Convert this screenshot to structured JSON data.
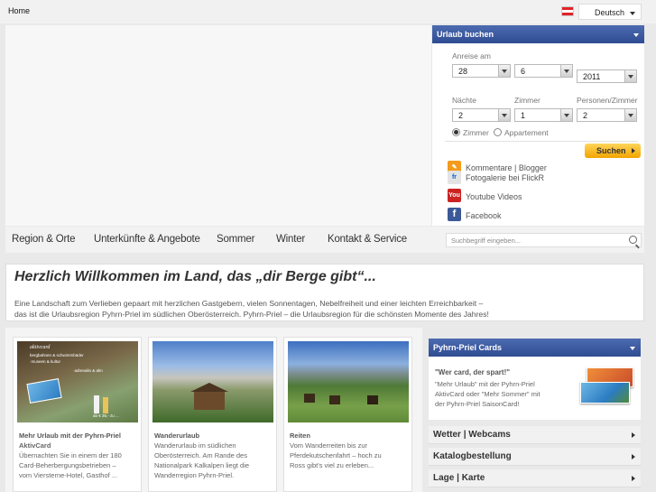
{
  "topbar": {
    "home": "Home",
    "language": "Deutsch"
  },
  "booking": {
    "title": "Urlaub buchen",
    "arrival_label": "Anreise am",
    "day": "28",
    "month": "6",
    "year": "2011",
    "nights_label": "Nächte",
    "rooms_label": "Zimmer",
    "persons_label": "Personen/Zimmer",
    "nights": "2",
    "rooms": "1",
    "persons": "2",
    "option_room": "Zimmer",
    "option_apartment": "Appartement",
    "search_button": "Suchen",
    "social": [
      {
        "label": "Kommentare | Blogger",
        "icon": "blogger-icon",
        "color": "#f29b1c"
      },
      {
        "label": "Fotogalerie bei FlickR",
        "icon": "flickr-icon",
        "color": "#e3e3e3"
      },
      {
        "label": "Youtube Videos",
        "icon": "youtube-icon",
        "color": "#cc2222"
      },
      {
        "label": "Facebook",
        "icon": "facebook-icon",
        "color": "#3b5998"
      }
    ]
  },
  "nav": {
    "items": [
      "Region & Orte",
      "Unterkünfte & Angebote",
      "Sommer",
      "Winter",
      "Kontakt & Service"
    ],
    "search_placeholder": "Suchbegriff eingeben..."
  },
  "welcome": {
    "title": "Herzlich Willkommen im Land, das „dir Berge gibt“...",
    "line1": "Eine Landschaft zum Verlieben gepaart mit herzlichen Gastgebern, vielen Sonnentagen, Nebelfreiheit und einer leichten Erreichbarkeit –",
    "line2": "das ist die Urlaubsregion Pyhrn-Priel im südlichen Oberösterreich. Pyhrn-Priel – die Urlaubsregion für die schönsten Momente des Jahres!"
  },
  "cards": [
    {
      "title": "Mehr Urlaub mit der Pyhrn-Priel",
      "lines": [
        "AktivCard",
        "Übernachten Sie in einem der 180",
        "Card-Beherbergungsbetrieben –",
        "vom Viersterne-Hotel, Gasthof ..."
      ]
    },
    {
      "title": "Wanderurlaub",
      "lines": [
        "Wanderurlaub im südlichen",
        "Oberösterreich. Am Rande des",
        "Nationalpark Kalkalpen liegt die",
        "Wanderregion Pyhrn-Priel."
      ]
    },
    {
      "title": "Reiten",
      "lines": [
        "Vom Wanderreiten bis zur",
        "Pferdekutschenfahrt – hoch zu",
        "Ross gibt's viel zu erleben..."
      ]
    }
  ],
  "card_image_text": {
    "aktiv": [
      "aktivcard",
      "bergbahnen & schwimmbäder",
      "·museen & kultur",
      "·adrenalin & alm",
      "ab € 36,- zu ..."
    ]
  },
  "sidebar": {
    "cards_title": "Pyhrn-Priel Cards",
    "cards_quote": "\"Wer card, der spart!\"",
    "cards_text": [
      "\"Mehr Urlaub\" mit der Pyhrn-Priel",
      "AktivCard oder \"Mehr Sommer\" mit",
      "der Pyhrn-Priel SaisonCard!"
    ],
    "accordion": [
      "Wetter | Webcams",
      "Katalogbestellung",
      "Lage | Karte"
    ]
  }
}
